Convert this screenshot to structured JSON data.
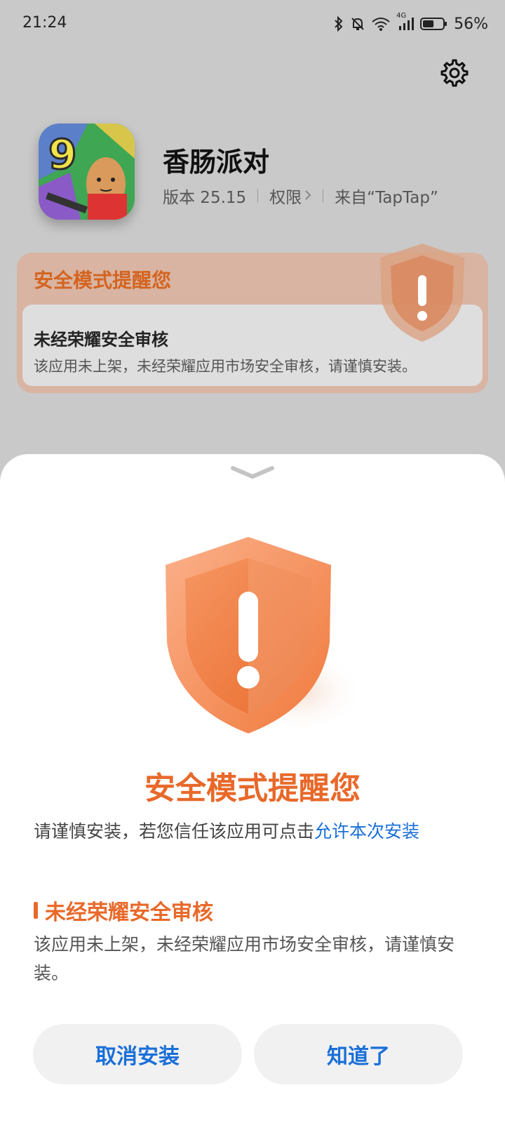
{
  "status_bar": {
    "time": "21:24",
    "network_label": "4G",
    "battery_percent": "56%",
    "battery_level": 0.56,
    "icons": [
      "bluetooth-icon",
      "mute-icon",
      "wifi-icon",
      "signal-icon",
      "battery-icon"
    ]
  },
  "app": {
    "name": "香肠派对",
    "version": "版本 25.15",
    "permissions_label": "权限",
    "source": "来自“TapTap”",
    "icon_badge": "9"
  },
  "bg_card": {
    "title": "安全模式提醒您",
    "subtitle": "未经荣耀安全审核",
    "text": "该应用未上架，未经荣耀应用市场安全审核，请谨慎安装。"
  },
  "sheet": {
    "title": "安全模式提醒您",
    "desc_prefix": "请谨慎安装，若您信任该应用可点击",
    "allow_link": "允许本次安装",
    "warning_title": "未经荣耀安全审核",
    "warning_text": "该应用未上架，未经荣耀应用市场安全审核，请谨慎安装。",
    "cancel_button": "取消安装",
    "ok_button": "知道了"
  },
  "colors": {
    "accent_orange": "#e8692a",
    "link_blue": "#1a6fd8",
    "dim_overlay": "#c9c9c9"
  }
}
